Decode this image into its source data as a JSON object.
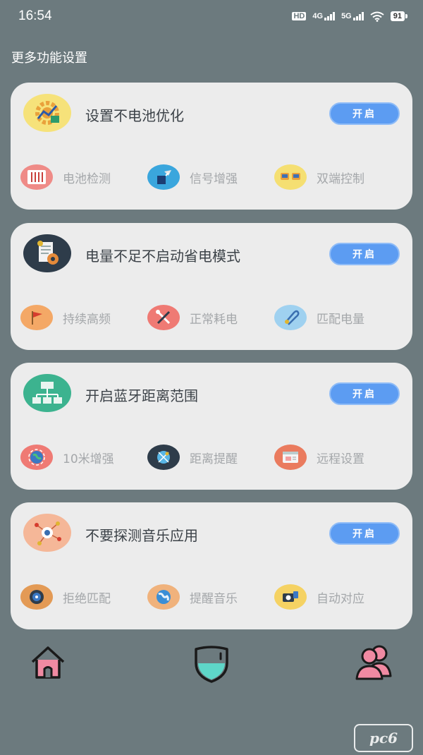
{
  "status_bar": {
    "time": "16:54",
    "hd_label": "HD",
    "sim1_label": "4G",
    "sim2_label": "5G",
    "battery": "91"
  },
  "page_title": "更多功能设置",
  "cards": [
    {
      "title": "设置不电池优化",
      "button": "开启",
      "icon": "gear-chart-icon",
      "features": [
        {
          "label": "电池检测",
          "icon": "equalizer-icon"
        },
        {
          "label": "信号增强",
          "icon": "signal-icon"
        },
        {
          "label": "双端控制",
          "icon": "dual-device-icon"
        }
      ]
    },
    {
      "title": "电量不足不启动省电模式",
      "button": "开启",
      "icon": "document-gear-icon",
      "features": [
        {
          "label": "持续高频",
          "icon": "flag-icon"
        },
        {
          "label": "正常耗电",
          "icon": "tools-icon"
        },
        {
          "label": "匹配电量",
          "icon": "paperclip-icon"
        }
      ]
    },
    {
      "title": "开启蓝牙距离范围",
      "button": "开启",
      "icon": "network-tree-icon",
      "features": [
        {
          "label": "10米增强",
          "icon": "globe-icon"
        },
        {
          "label": "距离提醒",
          "icon": "satellite-icon"
        },
        {
          "label": "远程设置",
          "icon": "browser-window-icon"
        }
      ]
    },
    {
      "title": "不要探测音乐应用",
      "button": "开启",
      "icon": "eye-nodes-icon",
      "features": [
        {
          "label": "拒绝匹配",
          "icon": "vinyl-disc-icon"
        },
        {
          "label": "提醒音乐",
          "icon": "world-map-icon"
        },
        {
          "label": "自动对应",
          "icon": "camera-card-icon"
        }
      ]
    }
  ],
  "nav": {
    "items": [
      {
        "name": "home",
        "icon": "home-icon"
      },
      {
        "name": "shield",
        "icon": "shield-icon"
      },
      {
        "name": "users",
        "icon": "users-icon"
      }
    ]
  },
  "watermark": "pc6",
  "colors": {
    "background": "#6c7a7e",
    "card": "#ececec",
    "button": "#5c9cf2",
    "nav_stroke": "#1a1a1a",
    "nav_accent_pink": "#f08aa2",
    "nav_accent_teal": "#5ed6c8"
  }
}
